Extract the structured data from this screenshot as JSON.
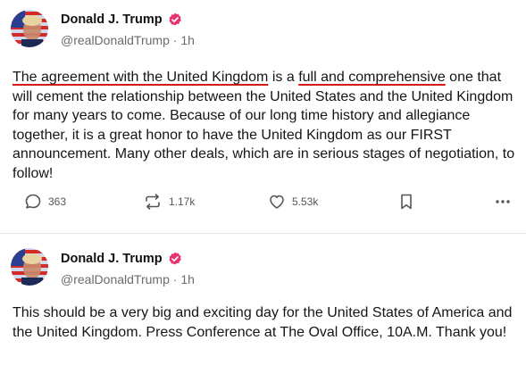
{
  "posts": [
    {
      "author": {
        "name": "Donald J. Trump",
        "handle": "@realDonaldTrump",
        "separator": "·",
        "time": "1h"
      },
      "text": {
        "underlined_1": "The agreement with the United Kingdom",
        "plain_1": " is a ",
        "underlined_2": "full and comprehensive",
        "plain_2": " one that will cement the relationship between the United States and the United Kingdom for many years to come. Because of our long time history and allegiance together, it is a great honor to have the United Kingdom as our FIRST announcement. Many other deals, which are in serious stages of negotiation, to follow!"
      },
      "actions": {
        "replies": "363",
        "reposts": "1.17k",
        "likes": "5.53k",
        "bookmark_icon": "bookmark-icon",
        "more_icon": "more-icon"
      }
    },
    {
      "author": {
        "name": "Donald J. Trump",
        "handle": "@realDonaldTrump",
        "separator": "·",
        "time": "1h"
      },
      "text": "This should be a very big and exciting day for the United States of America and the United Kingdom. Press Conference at The Oval Office, 10A.M. Thank you!"
    }
  ],
  "colors": {
    "verified": "#e8336e",
    "underline": "#d11a1a",
    "muted": "#6b6b6b"
  }
}
